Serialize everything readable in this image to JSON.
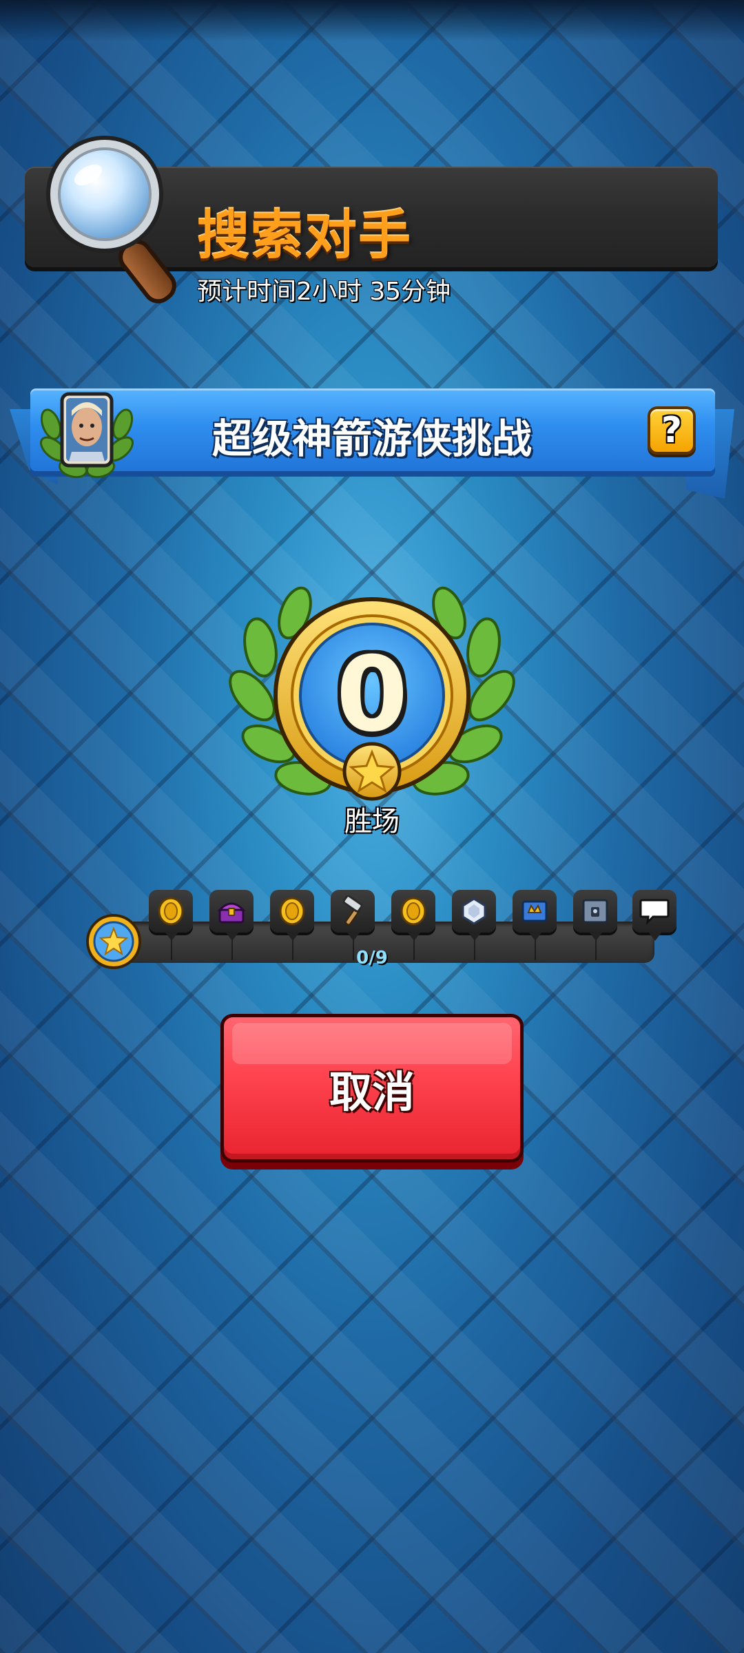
{
  "search": {
    "title": "搜索对手",
    "eta": "预计时间2小时 35分钟",
    "icon": "magnifier-icon"
  },
  "challenge": {
    "title": "超级神箭游侠挑战",
    "help_label": "?",
    "portrait_icon": "hero-portrait-icon"
  },
  "wins": {
    "count": "0",
    "label": "胜场"
  },
  "rewards": {
    "progress_text": "0/9",
    "progress_fraction": 0,
    "items": [
      {
        "icon": "gold-coin-icon"
      },
      {
        "icon": "magic-chest-icon"
      },
      {
        "icon": "gold-coin-icon"
      },
      {
        "icon": "hammer-icon"
      },
      {
        "icon": "gold-coin-icon"
      },
      {
        "icon": "crystal-icon"
      },
      {
        "icon": "banner-icon"
      },
      {
        "icon": "lock-chest-icon"
      },
      {
        "icon": "emote-bubble-icon"
      }
    ]
  },
  "cancel": {
    "label": "取消"
  },
  "colors": {
    "title_orange": "#ff9f1c",
    "banner_blue": "#2e8eef",
    "cancel_red": "#ff4450",
    "progress_text": "#8fe0ff"
  }
}
